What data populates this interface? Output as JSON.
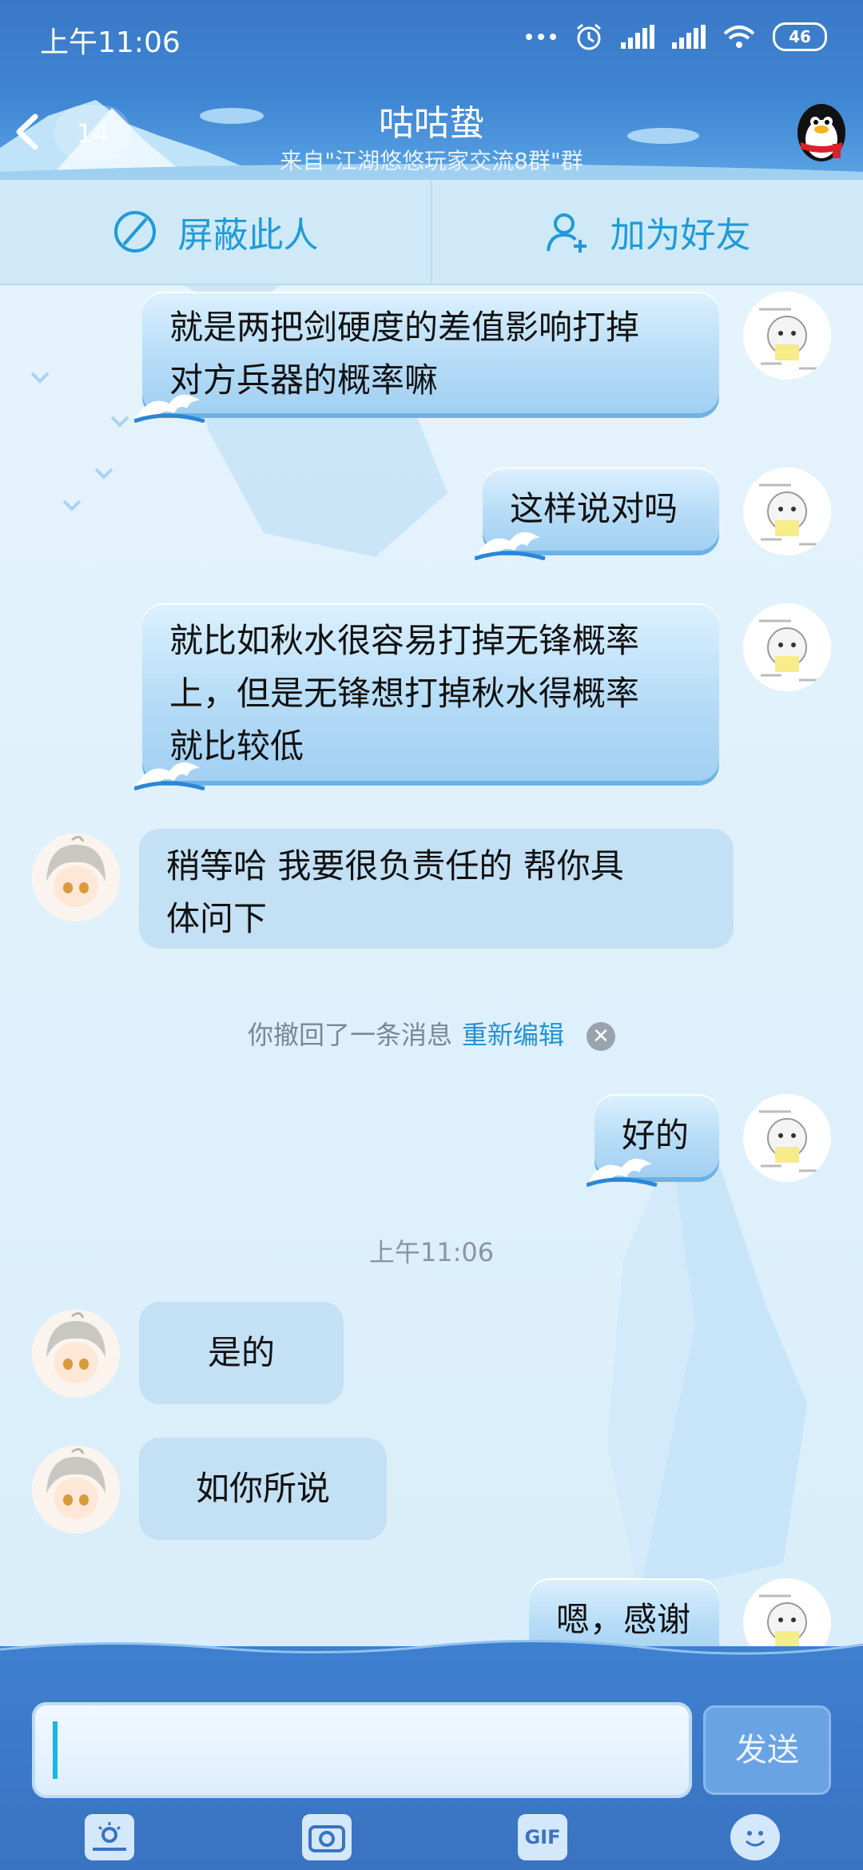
{
  "status_bar": {
    "time": "上午11:06",
    "battery": "46"
  },
  "header": {
    "unread_count": "14",
    "title": "咕咕蛰",
    "subtitle": "来自\"江湖悠悠玩家交流8群\"群"
  },
  "actions": {
    "block_label": "屏蔽此人",
    "add_friend_label": "加为好友"
  },
  "messages": [
    {
      "from": "self",
      "lines": [
        "就是两把剑硬度的差值影响打掉",
        "对方兵器的概率嘛"
      ]
    },
    {
      "from": "self",
      "lines": [
        "这样说对吗"
      ]
    },
    {
      "from": "self",
      "lines": [
        "就比如秋水很容易打掉无锋概率",
        "上，但是无锋想打掉秋水得概率",
        "就比较低"
      ]
    },
    {
      "from": "other",
      "lines": [
        "稍等哈 我要很负责任的 帮你具",
        "体问下"
      ]
    },
    {
      "from": "self",
      "lines": [
        "好的"
      ]
    },
    {
      "from": "other",
      "lines": [
        "是的"
      ]
    },
    {
      "from": "other",
      "lines": [
        "如你所说"
      ]
    },
    {
      "from": "self",
      "lines": [
        "嗯，感谢"
      ]
    }
  ],
  "recall_notice": {
    "text": "你撤回了一条消息",
    "link": "重新编辑"
  },
  "timestamp": "上午11:06",
  "composer": {
    "send_label": "发送",
    "gif_label": "GIF"
  },
  "icons": [
    "back-arrow-icon",
    "penguin-icon",
    "block-icon",
    "add-friend-icon",
    "wave-icon",
    "close-icon",
    "photo-icon",
    "camera-icon",
    "gif-icon",
    "emoji-icon"
  ],
  "colors": {
    "header": "#3f86d3",
    "accent": "#1f9ad8",
    "chat_bg": "#e5f3fc",
    "self_bubble": "#b6dcf7",
    "other_bubble": "#c3e0f5"
  }
}
